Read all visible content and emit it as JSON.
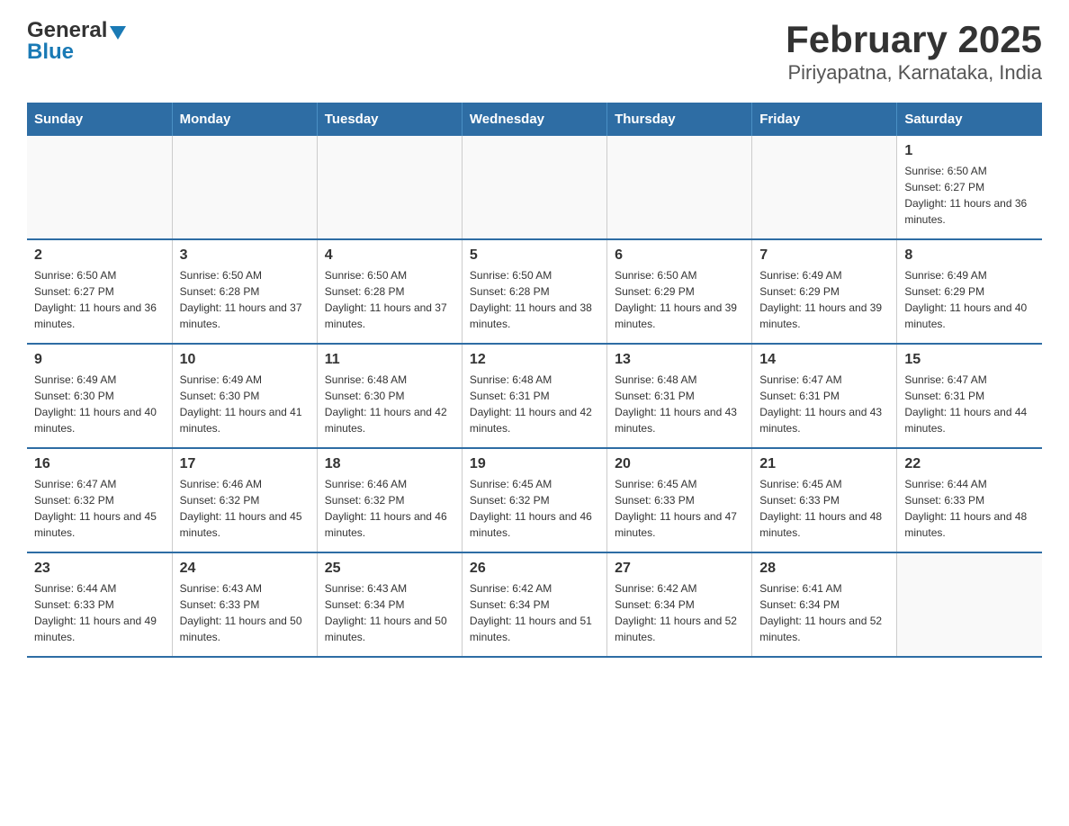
{
  "logo": {
    "general": "General",
    "blue": "Blue"
  },
  "title": "February 2025",
  "subtitle": "Piriyapatna, Karnataka, India",
  "weekdays": [
    "Sunday",
    "Monday",
    "Tuesday",
    "Wednesday",
    "Thursday",
    "Friday",
    "Saturday"
  ],
  "weeks": [
    [
      {
        "day": "",
        "sunrise": "",
        "sunset": "",
        "daylight": "",
        "empty": true
      },
      {
        "day": "",
        "sunrise": "",
        "sunset": "",
        "daylight": "",
        "empty": true
      },
      {
        "day": "",
        "sunrise": "",
        "sunset": "",
        "daylight": "",
        "empty": true
      },
      {
        "day": "",
        "sunrise": "",
        "sunset": "",
        "daylight": "",
        "empty": true
      },
      {
        "day": "",
        "sunrise": "",
        "sunset": "",
        "daylight": "",
        "empty": true
      },
      {
        "day": "",
        "sunrise": "",
        "sunset": "",
        "daylight": "",
        "empty": true
      },
      {
        "day": "1",
        "sunrise": "Sunrise: 6:50 AM",
        "sunset": "Sunset: 6:27 PM",
        "daylight": "Daylight: 11 hours and 36 minutes.",
        "empty": false
      }
    ],
    [
      {
        "day": "2",
        "sunrise": "Sunrise: 6:50 AM",
        "sunset": "Sunset: 6:27 PM",
        "daylight": "Daylight: 11 hours and 36 minutes.",
        "empty": false
      },
      {
        "day": "3",
        "sunrise": "Sunrise: 6:50 AM",
        "sunset": "Sunset: 6:28 PM",
        "daylight": "Daylight: 11 hours and 37 minutes.",
        "empty": false
      },
      {
        "day": "4",
        "sunrise": "Sunrise: 6:50 AM",
        "sunset": "Sunset: 6:28 PM",
        "daylight": "Daylight: 11 hours and 37 minutes.",
        "empty": false
      },
      {
        "day": "5",
        "sunrise": "Sunrise: 6:50 AM",
        "sunset": "Sunset: 6:28 PM",
        "daylight": "Daylight: 11 hours and 38 minutes.",
        "empty": false
      },
      {
        "day": "6",
        "sunrise": "Sunrise: 6:50 AM",
        "sunset": "Sunset: 6:29 PM",
        "daylight": "Daylight: 11 hours and 39 minutes.",
        "empty": false
      },
      {
        "day": "7",
        "sunrise": "Sunrise: 6:49 AM",
        "sunset": "Sunset: 6:29 PM",
        "daylight": "Daylight: 11 hours and 39 minutes.",
        "empty": false
      },
      {
        "day": "8",
        "sunrise": "Sunrise: 6:49 AM",
        "sunset": "Sunset: 6:29 PM",
        "daylight": "Daylight: 11 hours and 40 minutes.",
        "empty": false
      }
    ],
    [
      {
        "day": "9",
        "sunrise": "Sunrise: 6:49 AM",
        "sunset": "Sunset: 6:30 PM",
        "daylight": "Daylight: 11 hours and 40 minutes.",
        "empty": false
      },
      {
        "day": "10",
        "sunrise": "Sunrise: 6:49 AM",
        "sunset": "Sunset: 6:30 PM",
        "daylight": "Daylight: 11 hours and 41 minutes.",
        "empty": false
      },
      {
        "day": "11",
        "sunrise": "Sunrise: 6:48 AM",
        "sunset": "Sunset: 6:30 PM",
        "daylight": "Daylight: 11 hours and 42 minutes.",
        "empty": false
      },
      {
        "day": "12",
        "sunrise": "Sunrise: 6:48 AM",
        "sunset": "Sunset: 6:31 PM",
        "daylight": "Daylight: 11 hours and 42 minutes.",
        "empty": false
      },
      {
        "day": "13",
        "sunrise": "Sunrise: 6:48 AM",
        "sunset": "Sunset: 6:31 PM",
        "daylight": "Daylight: 11 hours and 43 minutes.",
        "empty": false
      },
      {
        "day": "14",
        "sunrise": "Sunrise: 6:47 AM",
        "sunset": "Sunset: 6:31 PM",
        "daylight": "Daylight: 11 hours and 43 minutes.",
        "empty": false
      },
      {
        "day": "15",
        "sunrise": "Sunrise: 6:47 AM",
        "sunset": "Sunset: 6:31 PM",
        "daylight": "Daylight: 11 hours and 44 minutes.",
        "empty": false
      }
    ],
    [
      {
        "day": "16",
        "sunrise": "Sunrise: 6:47 AM",
        "sunset": "Sunset: 6:32 PM",
        "daylight": "Daylight: 11 hours and 45 minutes.",
        "empty": false
      },
      {
        "day": "17",
        "sunrise": "Sunrise: 6:46 AM",
        "sunset": "Sunset: 6:32 PM",
        "daylight": "Daylight: 11 hours and 45 minutes.",
        "empty": false
      },
      {
        "day": "18",
        "sunrise": "Sunrise: 6:46 AM",
        "sunset": "Sunset: 6:32 PM",
        "daylight": "Daylight: 11 hours and 46 minutes.",
        "empty": false
      },
      {
        "day": "19",
        "sunrise": "Sunrise: 6:45 AM",
        "sunset": "Sunset: 6:32 PM",
        "daylight": "Daylight: 11 hours and 46 minutes.",
        "empty": false
      },
      {
        "day": "20",
        "sunrise": "Sunrise: 6:45 AM",
        "sunset": "Sunset: 6:33 PM",
        "daylight": "Daylight: 11 hours and 47 minutes.",
        "empty": false
      },
      {
        "day": "21",
        "sunrise": "Sunrise: 6:45 AM",
        "sunset": "Sunset: 6:33 PM",
        "daylight": "Daylight: 11 hours and 48 minutes.",
        "empty": false
      },
      {
        "day": "22",
        "sunrise": "Sunrise: 6:44 AM",
        "sunset": "Sunset: 6:33 PM",
        "daylight": "Daylight: 11 hours and 48 minutes.",
        "empty": false
      }
    ],
    [
      {
        "day": "23",
        "sunrise": "Sunrise: 6:44 AM",
        "sunset": "Sunset: 6:33 PM",
        "daylight": "Daylight: 11 hours and 49 minutes.",
        "empty": false
      },
      {
        "day": "24",
        "sunrise": "Sunrise: 6:43 AM",
        "sunset": "Sunset: 6:33 PM",
        "daylight": "Daylight: 11 hours and 50 minutes.",
        "empty": false
      },
      {
        "day": "25",
        "sunrise": "Sunrise: 6:43 AM",
        "sunset": "Sunset: 6:34 PM",
        "daylight": "Daylight: 11 hours and 50 minutes.",
        "empty": false
      },
      {
        "day": "26",
        "sunrise": "Sunrise: 6:42 AM",
        "sunset": "Sunset: 6:34 PM",
        "daylight": "Daylight: 11 hours and 51 minutes.",
        "empty": false
      },
      {
        "day": "27",
        "sunrise": "Sunrise: 6:42 AM",
        "sunset": "Sunset: 6:34 PM",
        "daylight": "Daylight: 11 hours and 52 minutes.",
        "empty": false
      },
      {
        "day": "28",
        "sunrise": "Sunrise: 6:41 AM",
        "sunset": "Sunset: 6:34 PM",
        "daylight": "Daylight: 11 hours and 52 minutes.",
        "empty": false
      },
      {
        "day": "",
        "sunrise": "",
        "sunset": "",
        "daylight": "",
        "empty": true
      }
    ]
  ]
}
